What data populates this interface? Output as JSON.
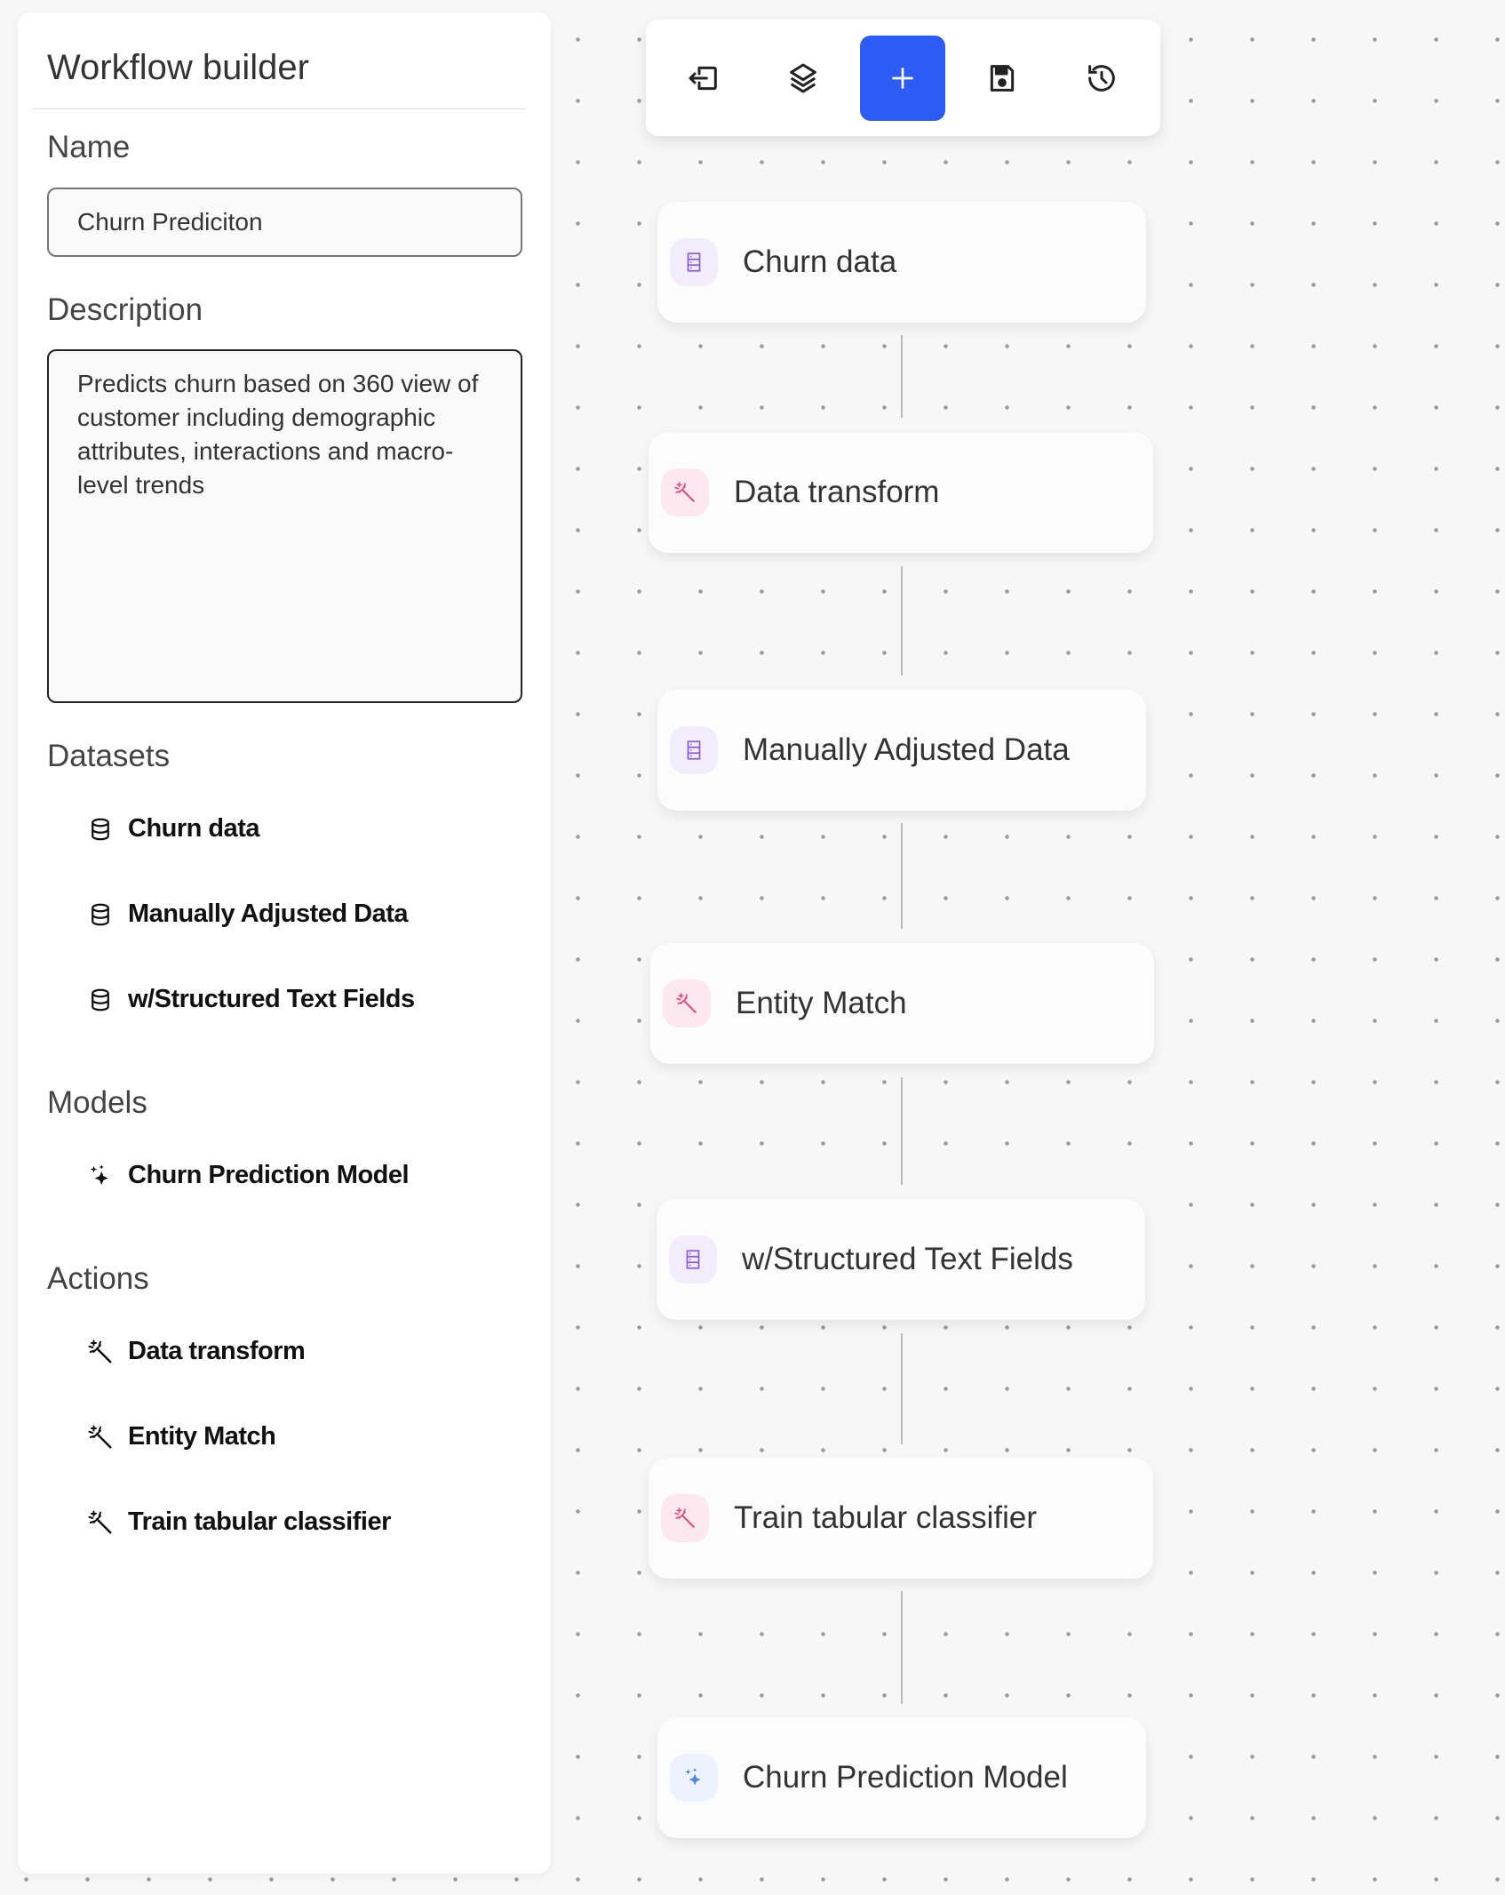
{
  "sidebar": {
    "title": "Workflow builder",
    "name_label": "Name",
    "name_value": "Churn Prediciton",
    "description_label": "Description",
    "description_value": "Predicts churn based on 360 view of customer including demographic attributes, interactions and macro-level trends",
    "datasets_label": "Datasets",
    "datasets": [
      "Churn data",
      "Manually Adjusted Data",
      "w/Structured Text Fields"
    ],
    "models_label": "Models",
    "models": [
      "Churn Prediction Model"
    ],
    "actions_label": "Actions",
    "actions": [
      "Data transform",
      "Entity Match",
      "Train tabular classifier"
    ]
  },
  "toolbar": {
    "buttons": [
      "exit-icon",
      "layers-icon",
      "plus-icon",
      "save-icon",
      "history-icon"
    ],
    "active": "plus-icon",
    "accent": "#2d5bf5"
  },
  "nodes": [
    {
      "label": "Churn data",
      "type": "dataset"
    },
    {
      "label": "Data transform",
      "type": "action"
    },
    {
      "label": "Manually Adjusted Data",
      "type": "dataset"
    },
    {
      "label": "Entity Match",
      "type": "action"
    },
    {
      "label": "w/Structured Text Fields",
      "type": "dataset"
    },
    {
      "label": "Train tabular classifier",
      "type": "action"
    },
    {
      "label": "Churn Prediction Model",
      "type": "model"
    }
  ],
  "colors": {
    "dataset": "#8b5cd6",
    "action": "#e0507f",
    "model": "#4a86e8"
  }
}
